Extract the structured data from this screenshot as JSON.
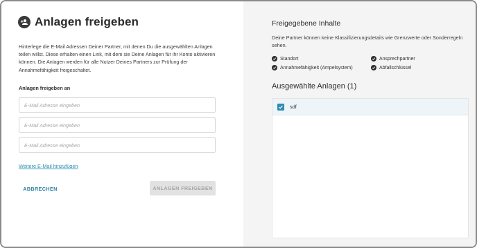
{
  "dialog": {
    "title": "Anlagen freigeben",
    "title_icon": "person-add-icon",
    "description": "Hinterlege die E-Mail Adressen Deiner Partner, mit denen Du die ausgewählten Anlagen teilen willst. Diese erhalten einen Link, mit dem sie Deine Anlagen für ihr Konto aktivieren können. Die Anlagen werden für alle Nutzer Deines Partners zur Prüfung der Annahmefähigkeit freigeschaltet.",
    "section_label": "Anlagen freigeben an",
    "email_fields": [
      {
        "placeholder": "E-Mail Adresse eingeben",
        "value": ""
      },
      {
        "placeholder": "E-Mail Adresse eingeben",
        "value": ""
      },
      {
        "placeholder": "E-Mail Adresse eingeben",
        "value": ""
      }
    ],
    "add_email_link": "Weitere E-Mail hinzufügen",
    "cancel_label": "ABBRECHEN",
    "share_label": "ANLAGEN FREIGEBEN",
    "share_enabled": false
  },
  "shared_content": {
    "title": "Freigegebene Inhalte",
    "description": "Deine Partner können keine Klassifizierungsdetails wie Grenzwerte oder Sonderregeln sehen.",
    "items": [
      {
        "label": "Standort",
        "icon": "check-circle-icon"
      },
      {
        "label": "Ansprechpartner",
        "icon": "check-circle-icon"
      },
      {
        "label": "Annahmefähigkeit (Ampelsystem)",
        "icon": "check-circle-icon"
      },
      {
        "label": "Abfallschlüssel",
        "icon": "check-circle-icon"
      }
    ]
  },
  "selected_assets": {
    "title": "Ausgewählte Anlagen (1)",
    "items": [
      {
        "name": "sdf",
        "checked": true
      }
    ]
  },
  "colors": {
    "accent": "#2f8bb0",
    "link": "#2a8fb0",
    "right_panel_bg": "#f4f4f4",
    "disabled_button_bg": "#e2e2e2"
  }
}
